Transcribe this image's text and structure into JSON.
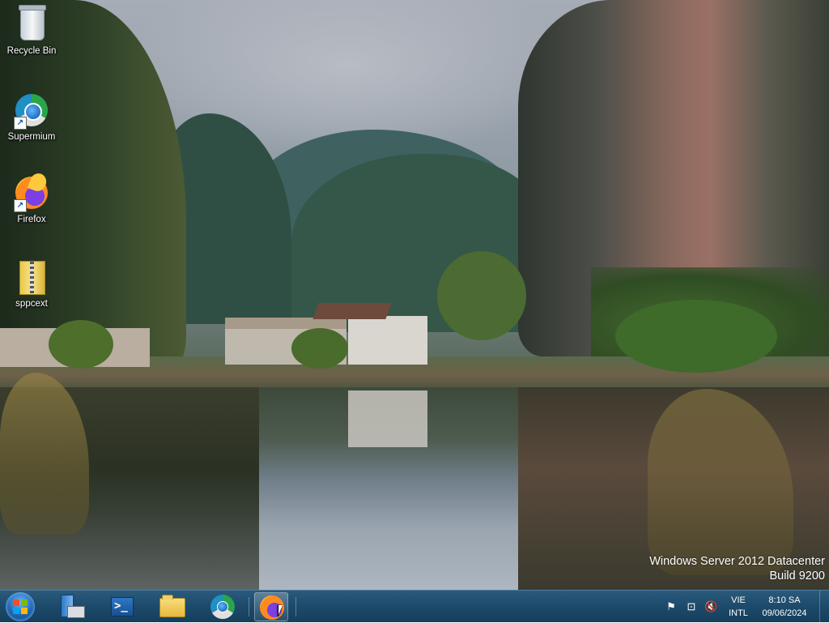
{
  "desktop": {
    "wallpaper": "karst mountains with village and lake reflection",
    "icons": [
      {
        "label": "Recycle Bin",
        "icon": "recycle-bin-icon"
      },
      {
        "label": "Supermium",
        "icon": "supermium-icon"
      },
      {
        "label": "Firefox",
        "icon": "firefox-icon"
      },
      {
        "label": "sppcext",
        "icon": "zip-folder-icon"
      }
    ],
    "watermark": {
      "line1": "Windows Server 2012 Datacenter",
      "line2": "Build 9200"
    }
  },
  "taskbar": {
    "start_icon": "windows-start-orb-icon",
    "pinned": [
      {
        "name": "Server Manager",
        "icon": "server-manager-icon",
        "active": false
      },
      {
        "name": "Windows PowerShell",
        "icon": "powershell-icon",
        "active": false
      },
      {
        "name": "File Explorer",
        "icon": "folder-icon",
        "active": false
      },
      {
        "name": "Supermium",
        "icon": "supermium-icon",
        "active": false
      },
      {
        "name": "Firefox",
        "icon": "firefox-icon",
        "active": true
      }
    ],
    "powershell_glyph": ">_",
    "tray": {
      "icons": [
        "flag-icon",
        "network-icon",
        "speaker-muted-icon"
      ],
      "language_top": "VIE",
      "language_bottom": "INTL",
      "time": "8:10 SA",
      "date": "09/06/2024"
    }
  },
  "colors": {
    "taskbar": "#1d4a6b",
    "taskbar_border": "#4f7c9c",
    "label_text": "#ffffff"
  }
}
